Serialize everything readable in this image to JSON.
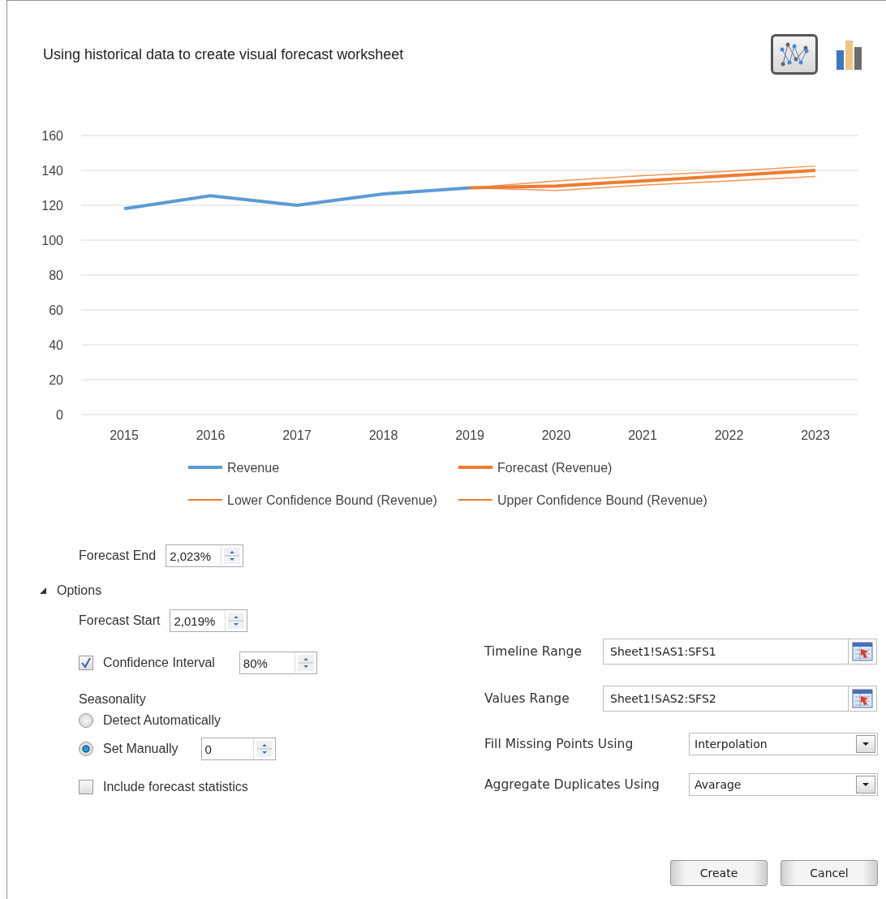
{
  "title": "Using historical data to create visual forecast worksheet",
  "view_toggle": [
    {
      "kind": "line",
      "selected": true
    },
    {
      "kind": "column",
      "selected": false
    }
  ],
  "chart_data": {
    "type": "line",
    "grid": true,
    "legend": "bottom",
    "categories": [
      "2015",
      "2016",
      "2017",
      "2018",
      "2019",
      "2020",
      "2021",
      "2022",
      "2023"
    ],
    "ylim": [
      0,
      160
    ],
    "yticks": [
      0,
      20,
      40,
      60,
      80,
      100,
      120,
      140,
      160
    ],
    "series": [
      {
        "name": "Revenue",
        "color": "#5b9bd5",
        "values": [
          118,
          125.5,
          120,
          126.5,
          130,
          null,
          null,
          null,
          null
        ]
      },
      {
        "name": "Forecast (Revenue)",
        "color": "#ed7d31",
        "values": [
          null,
          null,
          null,
          null,
          130,
          131,
          134,
          137,
          140
        ]
      },
      {
        "name": "Lower Confidence Bound (Revenue)",
        "color": "#ed7d31",
        "values": [
          null,
          null,
          null,
          null,
          130,
          128.5,
          131.5,
          134,
          136.5
        ]
      },
      {
        "name": "Upper Confidence Bound (Revenue)",
        "color": "#ed7d31",
        "values": [
          null,
          null,
          null,
          null,
          130,
          134,
          137,
          139.5,
          142.5
        ]
      }
    ]
  },
  "forecast_end": {
    "label": "Forecast End",
    "value": "2,023%"
  },
  "options": {
    "label": "Options",
    "expanded": true,
    "forecast_start": {
      "label": "Forecast Start",
      "value": "2,019%"
    },
    "confidence_interval": {
      "label": "Confidence Interval",
      "checked": true,
      "value": "80%"
    },
    "seasonality": {
      "label": "Seasonality",
      "choices": [
        {
          "label": "Detect Automatically",
          "selected": false
        },
        {
          "label": "Set Manually",
          "selected": true,
          "value": "0"
        }
      ]
    },
    "include_statistics": {
      "label": "Include forecast statistics",
      "checked": false
    },
    "timeline_range": {
      "label": "Timeline Range",
      "value": "Sheet1!SAS1:SFS1"
    },
    "values_range": {
      "label": "Values Range",
      "value": "Sheet1!SAS2:SFS2"
    },
    "fill_missing": {
      "label": "Fill Missing Points Using",
      "value": "Interpolation"
    },
    "aggregate_duplicates": {
      "label": "Aggregate Duplicates Using",
      "value": "Avarage"
    }
  },
  "buttons": [
    "Create",
    "Cancel"
  ]
}
